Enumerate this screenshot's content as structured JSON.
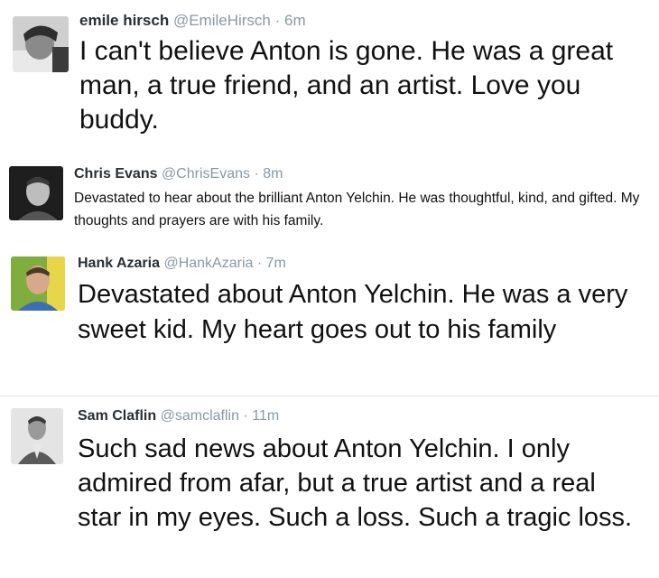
{
  "tweets": [
    {
      "name": "emile hirsch",
      "handle": "@EmileHirsch",
      "time": "6m",
      "text": "I can't believe Anton is gone. He was a great man, a true friend, and an artist. Love you buddy."
    },
    {
      "name": "Chris Evans",
      "handle": "@ChrisEvans",
      "time": "8m",
      "text": "Devastated to hear about the brilliant Anton Yelchin. He was thoughtful, kind, and gifted. My thoughts and prayers are with his family."
    },
    {
      "name": "Hank Azaria",
      "handle": "@HankAzaria",
      "time": "7m",
      "text": "Devastated about Anton Yelchin. He was a very sweet kid. My heart goes out to his family"
    },
    {
      "name": "Sam Claflin",
      "handle": "@samclaflin",
      "time": "11m",
      "text": "Such sad news about Anton Yelchin. I only admired from afar, but a true artist and a real star in my eyes. Such a loss. Such a tragic loss."
    }
  ],
  "separator": "·",
  "colors": {
    "name": "#292f33",
    "meta": "#8899a6",
    "text": "#111111",
    "divider": "#e1e8ed"
  }
}
